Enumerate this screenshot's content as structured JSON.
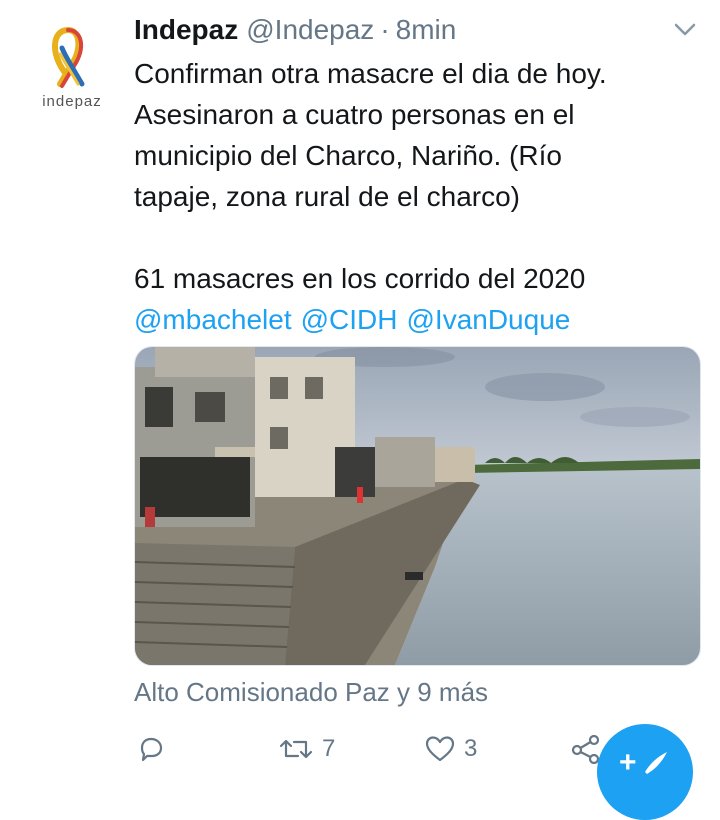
{
  "tweet": {
    "author_name": "Indepaz",
    "author_handle": "@Indepaz",
    "separator": "·",
    "time": "8min",
    "avatar_text": "indepaz",
    "text_lines": [
      "Confirman otra masacre el dia de hoy.",
      "Asesinaron a cuatro personas  en el",
      "municipio del Charco, Nariño. (Río",
      "tapaje, zona rural de el charco)",
      "",
      "61 masacres en los corrido del 2020"
    ],
    "mentions": [
      "@mbachelet",
      "@CIDH",
      "@IvanDuque"
    ],
    "reply_context": "Alto Comisionado Paz y 9 más"
  },
  "actions": {
    "reply_icon": "reply-icon",
    "retweet_icon": "retweet-icon",
    "retweet_count": "7",
    "like_icon": "heart-icon",
    "like_count": "3",
    "share_icon": "share-icon"
  },
  "fab": {
    "icon": "compose-icon",
    "label": "+"
  },
  "colors": {
    "accent": "#1da1f2",
    "text": "#14171a",
    "secondary": "#657786"
  }
}
